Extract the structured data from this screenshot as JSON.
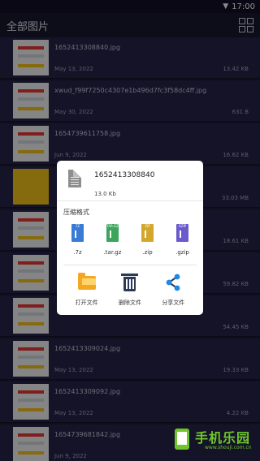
{
  "status": {
    "time": "17:00"
  },
  "header": {
    "title": "全部图片"
  },
  "files": [
    {
      "name": "1652413308840.jpg",
      "date": "May 13, 2022",
      "size": "13.42 KB",
      "thumb": "doc"
    },
    {
      "name": "xwud_f99f7250c4307e1b496d7fc3f58dc4ff.jpg",
      "date": "May 30, 2022",
      "size": "631 B",
      "thumb": "doc"
    },
    {
      "name": "1654739611758.jpg",
      "date": "Jun 9, 2022",
      "size": "16.62 KB",
      "thumb": "doc"
    },
    {
      "name": "",
      "date": "",
      "size": "33.03 MB",
      "thumb": "yellow"
    },
    {
      "name": "",
      "date": "",
      "size": "18.61 KB",
      "thumb": "doc"
    },
    {
      "name": "",
      "date": "",
      "size": "59.82 KB",
      "thumb": "doc"
    },
    {
      "name": "",
      "date": "",
      "size": "54.45 KB",
      "thumb": "doc"
    },
    {
      "name": "1652413309024.jpg",
      "date": "May 13, 2022",
      "size": "19.33 KB",
      "thumb": "doc"
    },
    {
      "name": "1652413309092.jpg",
      "date": "May 13, 2022",
      "size": "4.22 KB",
      "thumb": "doc"
    },
    {
      "name": "1654739681842.jpg",
      "date": "Jun 9, 2022",
      "size": "",
      "thumb": "doc"
    }
  ],
  "dialog": {
    "file_name": "1652413308840",
    "file_size": "13.0 Kb",
    "format_label": "压缩格式",
    "formats": [
      {
        "badge": "7Z",
        "caption": ".7z",
        "color": "#3a7bd5"
      },
      {
        "badge": "TAR.GZ",
        "caption": ".tar.gz",
        "color": "#3aa55b"
      },
      {
        "badge": "ZIP",
        "caption": ".zip",
        "color": "#d4a72c"
      },
      {
        "badge": "GZIP",
        "caption": ".gzip",
        "color": "#6a5acd"
      }
    ],
    "actions": {
      "open": "打开文件",
      "delete": "删除文件",
      "share": "分享文件"
    }
  },
  "watermark": {
    "text": "手机乐园",
    "sub": "www.shouji.com.cn"
  }
}
